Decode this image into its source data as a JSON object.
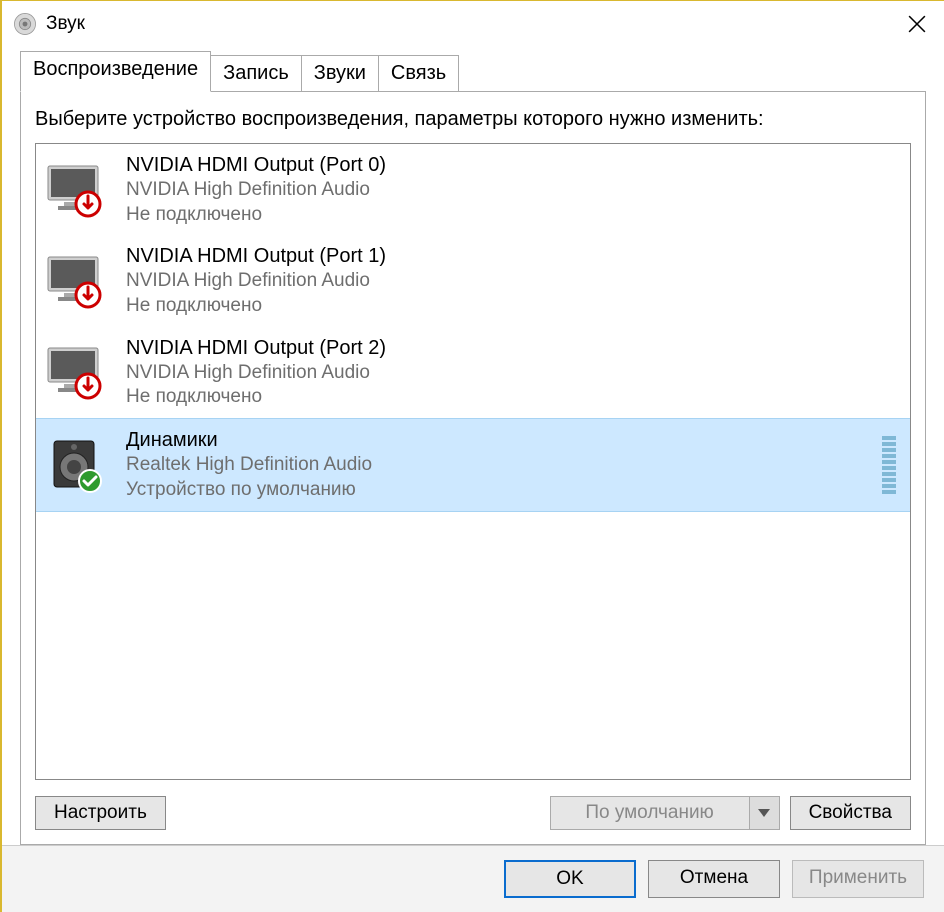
{
  "window": {
    "title": "Звук"
  },
  "tabs": [
    {
      "label": "Воспроизведение",
      "active": true
    },
    {
      "label": "Запись",
      "active": false
    },
    {
      "label": "Звуки",
      "active": false
    },
    {
      "label": "Связь",
      "active": false
    }
  ],
  "helptext": "Выберите устройство воспроизведения, параметры которого нужно изменить:",
  "devices": [
    {
      "name": "NVIDIA HDMI Output (Port 0)",
      "driver": "NVIDIA High Definition Audio",
      "status": "Не подключено",
      "icon": "monitor-disconnected",
      "selected": false
    },
    {
      "name": "NVIDIA HDMI Output (Port 1)",
      "driver": "NVIDIA High Definition Audio",
      "status": "Не подключено",
      "icon": "monitor-disconnected",
      "selected": false
    },
    {
      "name": "NVIDIA HDMI Output (Port 2)",
      "driver": "NVIDIA High Definition Audio",
      "status": "Не подключено",
      "icon": "monitor-disconnected",
      "selected": false
    },
    {
      "name": "Динамики",
      "driver": "Realtek High Definition Audio",
      "status": "Устройство по умолчанию",
      "icon": "speaker-default",
      "selected": true
    }
  ],
  "buttons": {
    "configure": "Настроить",
    "default_dropdown": "По умолчанию",
    "properties": "Свойства"
  },
  "footer": {
    "ok": "OK",
    "cancel": "Отмена",
    "apply": "Применить"
  }
}
